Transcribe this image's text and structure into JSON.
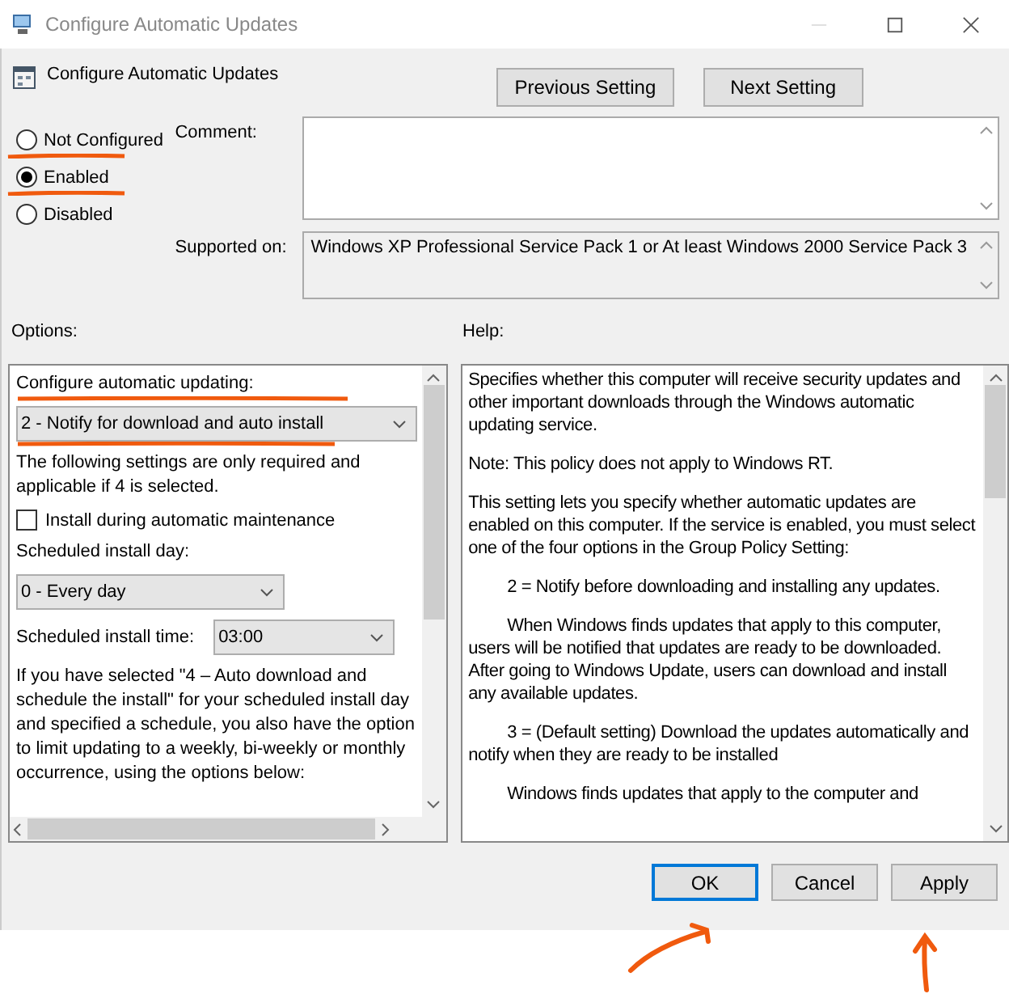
{
  "window": {
    "title": "Configure Automatic Updates"
  },
  "header": {
    "title": "Configure Automatic Updates",
    "buttons": [
      "Previous Setting",
      "Next Setting"
    ]
  },
  "state_options": [
    {
      "label": "Not Configured",
      "selected": false
    },
    {
      "label": "Enabled",
      "selected": true
    },
    {
      "label": "Disabled",
      "selected": false
    }
  ],
  "comment": {
    "label": "Comment:"
  },
  "supported_on": {
    "label": "Supported on:",
    "value": "Windows XP Professional Service Pack 1 or At least Windows 2000 Service Pack 3"
  },
  "options": {
    "label": "Options:",
    "items": [
      {
        "kind": "label",
        "text": "Configure automatic updating:"
      },
      {
        "kind": "dropdown",
        "value": "2 - Notify for download and auto install"
      },
      {
        "kind": "text",
        "text": "The following settings are only required and applicable if 4 is selected."
      },
      {
        "kind": "checkbox",
        "text": "Install during automatic maintenance",
        "checked": false
      },
      {
        "kind": "label",
        "text": "Scheduled install day:"
      },
      {
        "kind": "dropdown",
        "value": "0 - Every day"
      },
      {
        "kind": "dropdown-row",
        "text": "Scheduled install time:",
        "value": "03:00"
      },
      {
        "kind": "text",
        "text": "If you have selected \"4 – Auto download and schedule the install\" for your scheduled install day and specified a schedule, you also have the option to limit updating to a weekly, bi-weekly or monthly occurrence, using the options below:"
      }
    ]
  },
  "help": {
    "label": "Help:",
    "paragraphs": [
      {
        "text": "Specifies whether this computer will receive security updates and other important downloads through the Windows automatic updating service.",
        "indented": false
      },
      {
        "text": "Note: This policy does not apply to Windows RT.",
        "indented": false
      },
      {
        "text": "This setting lets you specify whether automatic updates are enabled on this computer. If the service is enabled, you must select one of the four options in the Group Policy Setting:",
        "indented": false
      },
      {
        "text": "2 = Notify before downloading and installing any updates.",
        "indented": true
      },
      {
        "text": "When Windows finds updates that apply to this computer, users will be notified that updates are ready to be downloaded. After going to Windows Update, users can download and install any available updates.",
        "indented": true
      },
      {
        "text": "3 = (Default setting) Download the updates automatically and notify when they are ready to be installed",
        "indented": true
      },
      {
        "text": "Windows finds updates that apply to the computer and",
        "indented": true
      }
    ]
  },
  "buttons": [
    {
      "label": "OK",
      "default": true
    },
    {
      "label": "Cancel",
      "default": false
    },
    {
      "label": "Apply",
      "default": false
    }
  ]
}
